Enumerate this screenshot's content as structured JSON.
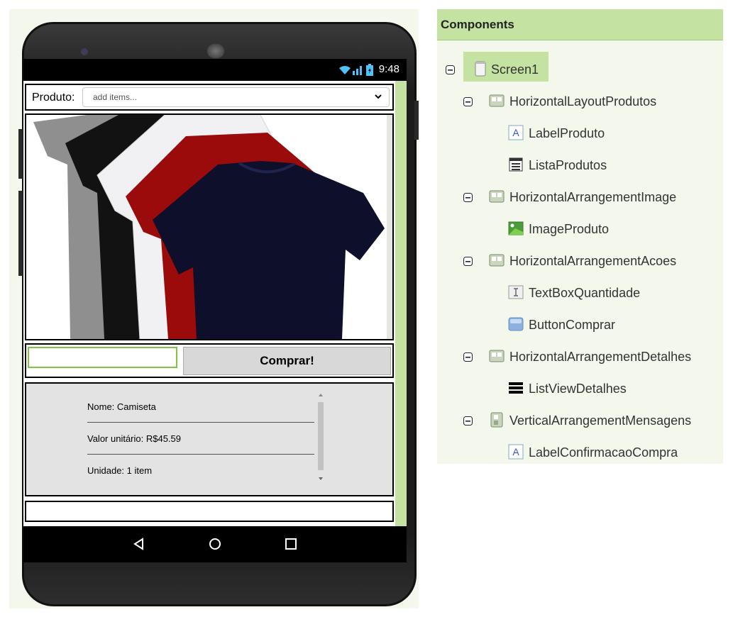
{
  "status_bar": {
    "time": "9:48"
  },
  "app": {
    "produto_label": "Produto:",
    "lista_placeholder": "add items...",
    "quantidade_value": "",
    "comprar_label": "Comprar!",
    "detalhes": [
      "Nome: Camiseta",
      "Valor unitário: R$45.59",
      "Unidade: 1 item"
    ],
    "confirmacao": ""
  },
  "components": {
    "title": "Components",
    "tree": [
      {
        "label": "Screen1",
        "icon": "screen-icon",
        "level": 0
      },
      {
        "label": "HorizontalLayoutProdutos",
        "icon": "horizontal-arrangement-icon",
        "level": 1
      },
      {
        "label": "LabelProduto",
        "icon": "label-icon",
        "level": 2
      },
      {
        "label": "ListaProdutos",
        "icon": "listpicker-icon",
        "level": 2
      },
      {
        "label": "HorizontalArrangementImage",
        "icon": "horizontal-arrangement-icon",
        "level": 1
      },
      {
        "label": "ImageProduto",
        "icon": "image-icon",
        "level": 2
      },
      {
        "label": "HorizontalArrangementAcoes",
        "icon": "horizontal-arrangement-icon",
        "level": 1
      },
      {
        "label": "TextBoxQuantidade",
        "icon": "textbox-icon",
        "level": 2
      },
      {
        "label": "ButtonComprar",
        "icon": "button-icon",
        "level": 2
      },
      {
        "label": "HorizontalArrangementDetalhes",
        "icon": "horizontal-arrangement-icon",
        "level": 1
      },
      {
        "label": "ListViewDetalhes",
        "icon": "listview-icon",
        "level": 2
      },
      {
        "label": "VerticalArrangementMensagens",
        "icon": "vertical-arrangement-icon",
        "level": 1
      },
      {
        "label": "LabelConfirmacaoCompra",
        "icon": "label-icon",
        "level": 2
      }
    ]
  },
  "colors": {
    "panel_header": "#c4e3a2",
    "selected_highlight": "#c4e3a2",
    "textbox_border": "#84c341",
    "shirt_colors": [
      "#8f8f8f",
      "#121212",
      "#f1f1f3",
      "#9b0b0b",
      "#0d0f2b"
    ]
  }
}
